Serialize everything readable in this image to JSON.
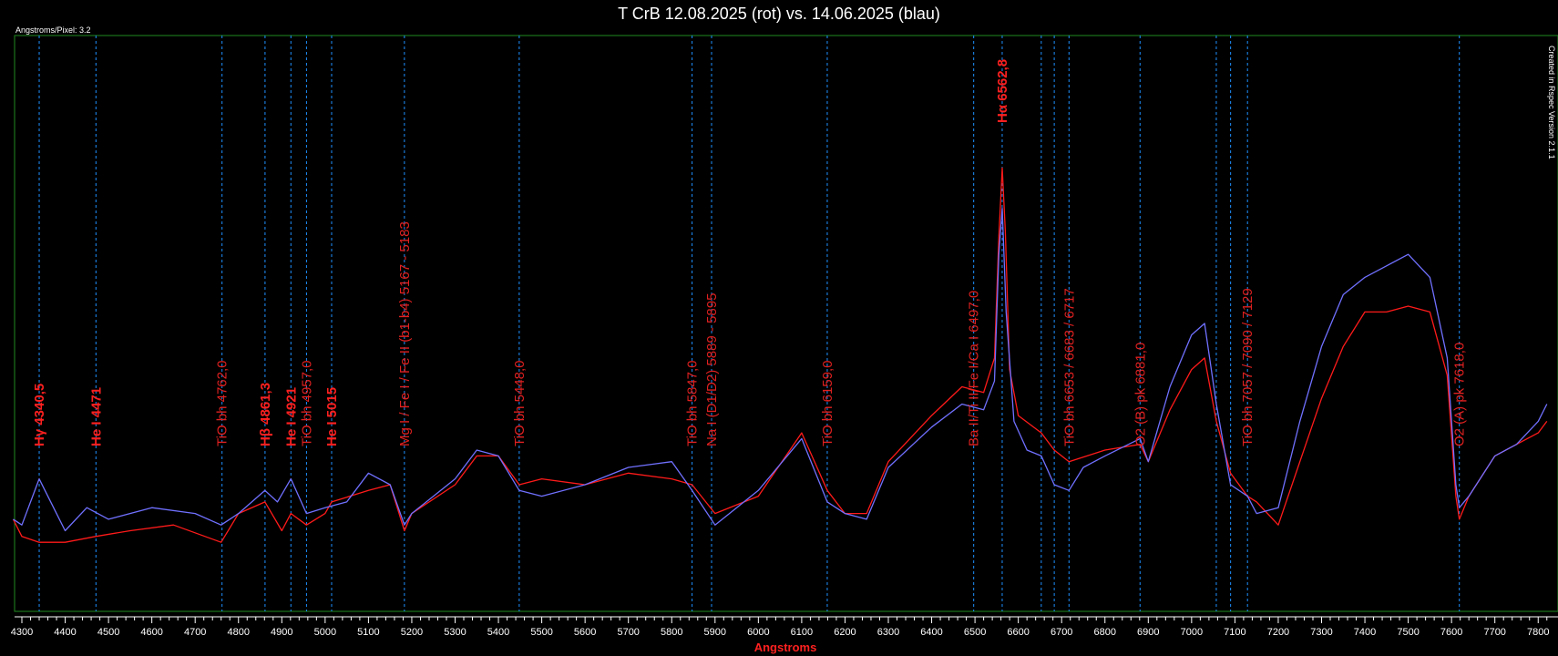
{
  "chart_data": {
    "type": "line",
    "title": "T CrB 12.08.2025 (rot) vs. 14.06.2025 (blau)",
    "xlabel": "Angstroms",
    "ylabel": "",
    "scale_note": "Angstroms/Pixel: 3.2",
    "credit": "Created in Rspec Version 2.1.1",
    "xlim": [
      4280,
      7820
    ],
    "ylim": [
      0,
      1
    ],
    "grid": false,
    "x_ticks": [
      4300,
      4400,
      4500,
      4600,
      4700,
      4800,
      4900,
      5000,
      5100,
      5200,
      5300,
      5400,
      5500,
      5600,
      5700,
      5800,
      5900,
      6000,
      6100,
      6200,
      6300,
      6400,
      6500,
      6600,
      6700,
      6800,
      6900,
      7000,
      7100,
      7200,
      7300,
      7400,
      7500,
      7600,
      7700,
      7800
    ],
    "x_tick_labels": [
      "4300",
      "4400",
      "4500",
      "4600",
      "4700",
      "4800",
      "4900",
      "5000",
      "5100",
      "5200",
      "5300",
      "5400",
      "5500",
      "5600",
      "5700",
      "5800",
      "5900",
      "6000",
      "6100",
      "6200",
      "6300",
      "6400",
      "6500",
      "6600",
      "6700",
      "6800",
      "6900",
      "7000",
      "7100",
      "7200",
      "7300",
      "7400",
      "7500",
      "7600",
      "7700",
      "7800"
    ],
    "colors": {
      "red": "#ff1a1a",
      "blue": "#7070ff",
      "marker": "#1e90ff",
      "frame": "#1f8a1f"
    },
    "series": [
      {
        "name": "12.08.2025 (rot)",
        "color": "#ff1a1a",
        "points": [
          [
            4280,
            0.16
          ],
          [
            4300,
            0.13
          ],
          [
            4340,
            0.12
          ],
          [
            4400,
            0.12
          ],
          [
            4470,
            0.13
          ],
          [
            4550,
            0.14
          ],
          [
            4650,
            0.15
          ],
          [
            4760,
            0.12
          ],
          [
            4800,
            0.17
          ],
          [
            4861,
            0.19
          ],
          [
            4900,
            0.14
          ],
          [
            4921,
            0.17
          ],
          [
            4957,
            0.15
          ],
          [
            5000,
            0.17
          ],
          [
            5015,
            0.19
          ],
          [
            5100,
            0.21
          ],
          [
            5150,
            0.22
          ],
          [
            5183,
            0.14
          ],
          [
            5200,
            0.17
          ],
          [
            5300,
            0.22
          ],
          [
            5350,
            0.27
          ],
          [
            5400,
            0.27
          ],
          [
            5448,
            0.22
          ],
          [
            5500,
            0.23
          ],
          [
            5600,
            0.22
          ],
          [
            5700,
            0.24
          ],
          [
            5800,
            0.23
          ],
          [
            5847,
            0.22
          ],
          [
            5900,
            0.17
          ],
          [
            6000,
            0.2
          ],
          [
            6100,
            0.31
          ],
          [
            6159,
            0.21
          ],
          [
            6200,
            0.17
          ],
          [
            6250,
            0.17
          ],
          [
            6300,
            0.26
          ],
          [
            6400,
            0.34
          ],
          [
            6470,
            0.39
          ],
          [
            6520,
            0.38
          ],
          [
            6545,
            0.44
          ],
          [
            6555,
            0.65
          ],
          [
            6562.8,
            0.77
          ],
          [
            6570,
            0.66
          ],
          [
            6580,
            0.42
          ],
          [
            6600,
            0.34
          ],
          [
            6653,
            0.31
          ],
          [
            6683,
            0.28
          ],
          [
            6717,
            0.26
          ],
          [
            6800,
            0.28
          ],
          [
            6881,
            0.29
          ],
          [
            6900,
            0.26
          ],
          [
            6950,
            0.35
          ],
          [
            7000,
            0.42
          ],
          [
            7030,
            0.44
          ],
          [
            7057,
            0.33
          ],
          [
            7090,
            0.24
          ],
          [
            7129,
            0.2
          ],
          [
            7150,
            0.19
          ],
          [
            7200,
            0.15
          ],
          [
            7250,
            0.26
          ],
          [
            7300,
            0.37
          ],
          [
            7350,
            0.46
          ],
          [
            7400,
            0.52
          ],
          [
            7450,
            0.52
          ],
          [
            7500,
            0.53
          ],
          [
            7550,
            0.52
          ],
          [
            7590,
            0.41
          ],
          [
            7610,
            0.2
          ],
          [
            7618,
            0.16
          ],
          [
            7640,
            0.2
          ],
          [
            7700,
            0.27
          ],
          [
            7750,
            0.29
          ],
          [
            7800,
            0.31
          ],
          [
            7820,
            0.33
          ]
        ]
      },
      {
        "name": "14.06.2025 (blau)",
        "color": "#7070ff",
        "points": [
          [
            4280,
            0.16
          ],
          [
            4300,
            0.15
          ],
          [
            4340,
            0.23
          ],
          [
            4380,
            0.17
          ],
          [
            4400,
            0.14
          ],
          [
            4450,
            0.18
          ],
          [
            4500,
            0.16
          ],
          [
            4600,
            0.18
          ],
          [
            4700,
            0.17
          ],
          [
            4760,
            0.15
          ],
          [
            4800,
            0.17
          ],
          [
            4861,
            0.21
          ],
          [
            4890,
            0.19
          ],
          [
            4921,
            0.23
          ],
          [
            4957,
            0.17
          ],
          [
            5000,
            0.18
          ],
          [
            5050,
            0.19
          ],
          [
            5100,
            0.24
          ],
          [
            5150,
            0.22
          ],
          [
            5183,
            0.15
          ],
          [
            5200,
            0.17
          ],
          [
            5300,
            0.23
          ],
          [
            5350,
            0.28
          ],
          [
            5400,
            0.27
          ],
          [
            5448,
            0.21
          ],
          [
            5500,
            0.2
          ],
          [
            5600,
            0.22
          ],
          [
            5700,
            0.25
          ],
          [
            5800,
            0.26
          ],
          [
            5847,
            0.21
          ],
          [
            5900,
            0.15
          ],
          [
            6000,
            0.21
          ],
          [
            6100,
            0.3
          ],
          [
            6159,
            0.19
          ],
          [
            6200,
            0.17
          ],
          [
            6250,
            0.16
          ],
          [
            6300,
            0.25
          ],
          [
            6400,
            0.32
          ],
          [
            6470,
            0.36
          ],
          [
            6520,
            0.35
          ],
          [
            6545,
            0.4
          ],
          [
            6555,
            0.62
          ],
          [
            6562.8,
            0.7
          ],
          [
            6572,
            0.52
          ],
          [
            6590,
            0.33
          ],
          [
            6620,
            0.28
          ],
          [
            6653,
            0.27
          ],
          [
            6683,
            0.22
          ],
          [
            6717,
            0.21
          ],
          [
            6750,
            0.25
          ],
          [
            6800,
            0.27
          ],
          [
            6881,
            0.3
          ],
          [
            6900,
            0.26
          ],
          [
            6950,
            0.39
          ],
          [
            7000,
            0.48
          ],
          [
            7030,
            0.5
          ],
          [
            7057,
            0.36
          ],
          [
            7090,
            0.22
          ],
          [
            7129,
            0.2
          ],
          [
            7150,
            0.17
          ],
          [
            7200,
            0.18
          ],
          [
            7250,
            0.33
          ],
          [
            7300,
            0.46
          ],
          [
            7350,
            0.55
          ],
          [
            7400,
            0.58
          ],
          [
            7450,
            0.6
          ],
          [
            7500,
            0.62
          ],
          [
            7550,
            0.58
          ],
          [
            7590,
            0.44
          ],
          [
            7610,
            0.22
          ],
          [
            7618,
            0.18
          ],
          [
            7640,
            0.2
          ],
          [
            7700,
            0.27
          ],
          [
            7750,
            0.29
          ],
          [
            7800,
            0.33
          ],
          [
            7820,
            0.36
          ]
        ]
      }
    ],
    "markers": [
      {
        "x": 4340,
        "label": "Hγ 4340,5",
        "bold": true
      },
      {
        "x": 4471,
        "label": "He I 4471",
        "bold": true
      },
      {
        "x": 4762,
        "label": "TiO bh 4762,0",
        "bold": false
      },
      {
        "x": 4861.3,
        "label": "Hβ 4861,3",
        "bold": true
      },
      {
        "x": 4921,
        "label": "He I 4921",
        "bold": true
      },
      {
        "x": 4957,
        "label": "TiO bh 4957,0",
        "bold": false
      },
      {
        "x": 5015,
        "label": "He I 5015",
        "bold": true
      },
      {
        "x": 5183,
        "label": "Mg I / Fe I / Fe II  (b1-b4) 5167 - 5183",
        "bold": false
      },
      {
        "x": 5448,
        "label": "TiO bh 5448,0",
        "bold": false
      },
      {
        "x": 5847,
        "label": "TiO bh 5847,0",
        "bold": false
      },
      {
        "x": 5892,
        "label": "Na I (D1/D2) 5889 - 5895",
        "bold": false
      },
      {
        "x": 6159,
        "label": "TiO bh 6159,0",
        "bold": false
      },
      {
        "x": 6497,
        "label": "Ba II/Ti II/Fe I/Ca I 6497,0",
        "bold": false
      },
      {
        "x": 6562.8,
        "label": "Hα 6562,8",
        "bold": true
      },
      {
        "x": 6653,
        "label": "",
        "bold": false
      },
      {
        "x": 6683,
        "label": "",
        "bold": false
      },
      {
        "x": 6717,
        "label": "TiO bh 6653 / 6683 / 6717",
        "bold": false
      },
      {
        "x": 6881,
        "label": "O2 (B) pk 6881,0",
        "bold": false
      },
      {
        "x": 7057,
        "label": "",
        "bold": false
      },
      {
        "x": 7090,
        "label": "",
        "bold": false
      },
      {
        "x": 7129,
        "label": "TiO bh 7057 / 7090 / 7129",
        "bold": false
      },
      {
        "x": 7618,
        "label": "O2 (A) pk 7618,0",
        "bold": false
      }
    ]
  }
}
